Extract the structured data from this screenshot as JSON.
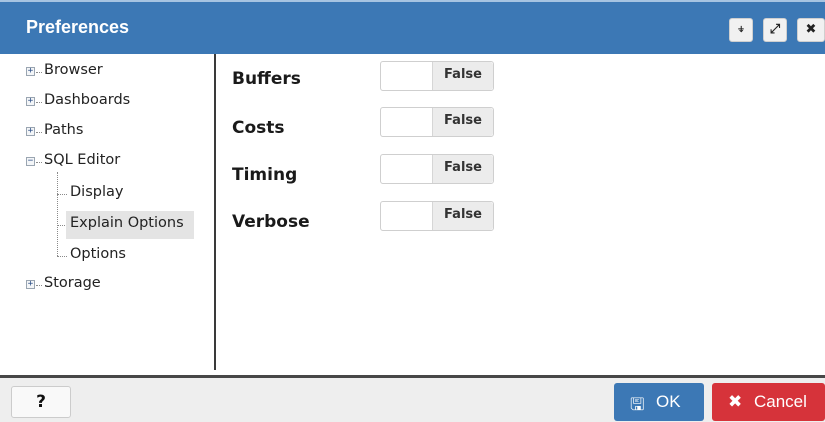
{
  "dialog": {
    "title": "Preferences"
  },
  "title_buttons": [
    {
      "name": "pin",
      "icon": "pin-icon",
      "glyph": "⍖"
    },
    {
      "name": "maximize",
      "icon": "maximize-icon",
      "glyph": "⤢"
    },
    {
      "name": "close",
      "icon": "close-icon",
      "glyph": "✖"
    }
  ],
  "tree": {
    "items": [
      {
        "label": "Browser",
        "expanded": false
      },
      {
        "label": "Dashboards",
        "expanded": false
      },
      {
        "label": "Paths",
        "expanded": false
      },
      {
        "label": "SQL Editor",
        "expanded": true,
        "children": [
          "Display",
          "Explain Options",
          "Options"
        ]
      },
      {
        "label": "Storage",
        "expanded": false
      }
    ],
    "selected": "Explain Options",
    "plus_glyph": "+",
    "minus_glyph": "−"
  },
  "properties": [
    {
      "label": "Buffers",
      "value": "False"
    },
    {
      "label": "Costs",
      "value": "False"
    },
    {
      "label": "Timing",
      "value": "False"
    },
    {
      "label": "Verbose",
      "value": "False"
    }
  ],
  "footer": {
    "help_label": "?",
    "ok_label": "OK",
    "cancel_label": "Cancel",
    "ok_icon": "save-icon",
    "cancel_icon": "x-icon",
    "ok_glyph": "🖫",
    "cancel_glyph": "✖"
  },
  "colors": {
    "header": "#3c78b5",
    "ok": "#3c78b5",
    "cancel": "#d6333a"
  }
}
